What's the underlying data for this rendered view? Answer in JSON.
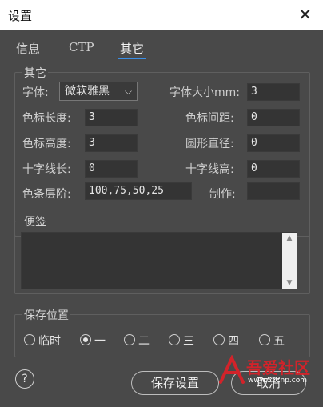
{
  "window": {
    "title": "设置",
    "close_glyph": "✕"
  },
  "tabs": [
    {
      "label": "信息",
      "active": false
    },
    {
      "label": "CTP",
      "active": false
    },
    {
      "label": "其它",
      "active": true
    }
  ],
  "other_group": {
    "title": "其它",
    "font_label": "字体:",
    "font_value": "微软雅黑",
    "font_size_label": "字体大小mm:",
    "font_size_value": "3",
    "mark_length_label": "色标长度:",
    "mark_length_value": "3",
    "mark_spacing_label": "色标间距:",
    "mark_spacing_value": "0",
    "mark_height_label": "色标高度:",
    "mark_height_value": "3",
    "circle_diameter_label": "圆形直径:",
    "circle_diameter_value": "0",
    "cross_length_label": "十字线长:",
    "cross_length_value": "0",
    "cross_height_label": "十字线高:",
    "cross_height_value": "0",
    "bar_steps_label": "色条层阶:",
    "bar_steps_value": "100,75,50,25",
    "maker_label": "制作:",
    "maker_value": ""
  },
  "notes_group": {
    "title": "便签",
    "value": ""
  },
  "save_location": {
    "title": "保存位置",
    "options": [
      {
        "label": "临时",
        "selected": false
      },
      {
        "label": "一",
        "selected": true
      },
      {
        "label": "二",
        "selected": false
      },
      {
        "label": "三",
        "selected": false
      },
      {
        "label": "四",
        "selected": false
      },
      {
        "label": "五",
        "selected": false
      }
    ]
  },
  "footer": {
    "help_glyph": "?",
    "save_label": "保存设置",
    "cancel_label": "取消"
  },
  "watermark": {
    "text": "吾爱社区",
    "url_text": "www.52cnp.com"
  },
  "colors": {
    "accent": "#3a8ee6",
    "panel": "#494949",
    "input": "#343434",
    "watermark_red": "#d2232a"
  }
}
